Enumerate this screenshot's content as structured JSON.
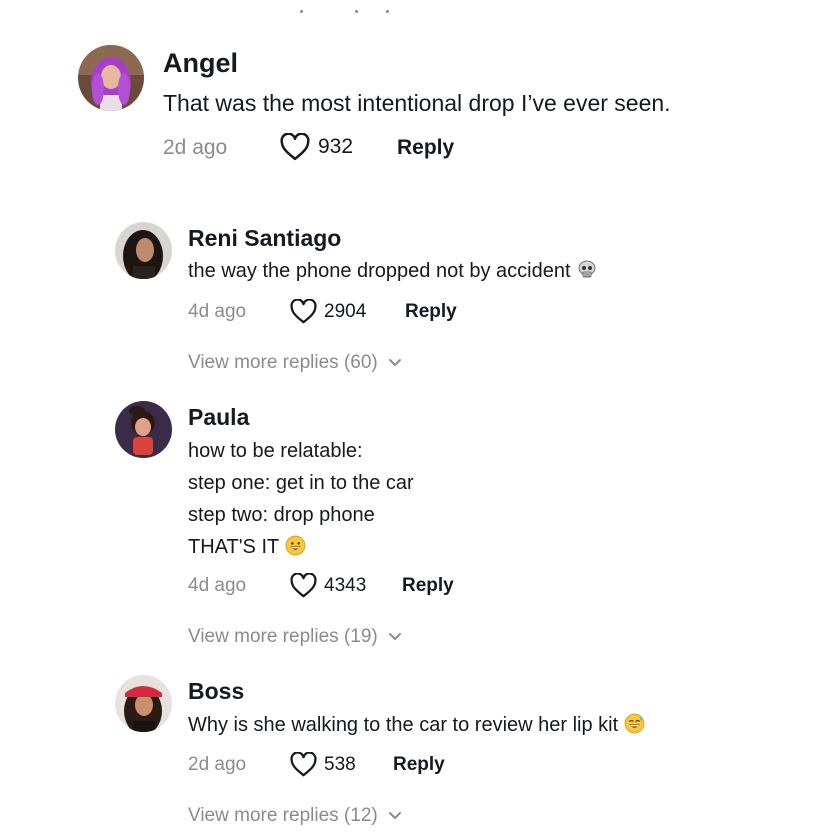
{
  "comments": [
    {
      "name": "Angel",
      "text": "That was the most intentional drop I’ve ever seen.",
      "time": "2d ago",
      "likes": "932",
      "reply": "Reply"
    },
    {
      "name": "Reni Santiago",
      "text": "the way the phone dropped not by accident",
      "emoji": "skull-emoji",
      "time": "4d ago",
      "likes": "2904",
      "reply": "Reply",
      "more": "View more replies (60)"
    },
    {
      "name": "Paula",
      "lines": [
        "how to be relatable:",
        "step one: get in to the car",
        "step two: drop phone",
        "THAT'S IT"
      ],
      "emoji": "grinning-emoji",
      "time": "4d ago",
      "likes": "4343",
      "reply": "Reply",
      "more": "View more replies (19)"
    },
    {
      "name": "Boss",
      "text": "Why is she walking to the car to review her lip kit",
      "emoji": "sweat-smile-emoji",
      "time": "2d ago",
      "likes": "538",
      "reply": "Reply",
      "more": "View more replies (12)"
    }
  ],
  "colors": {
    "text": "#161823",
    "muted": "#8a8b91",
    "background": "#ffffff"
  }
}
